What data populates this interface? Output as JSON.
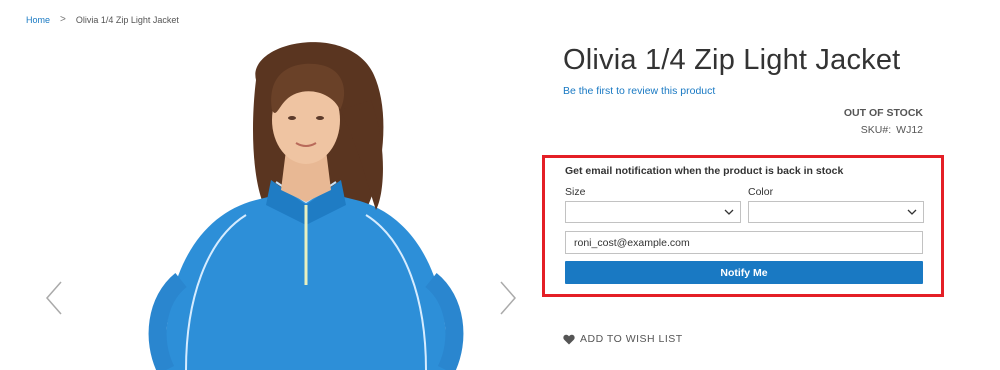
{
  "breadcrumb": {
    "home": "Home",
    "separator": ">",
    "current": "Olivia 1/4 Zip Light Jacket"
  },
  "gallery": {
    "prev_icon": "chevron-left-icon",
    "next_icon": "chevron-right-icon",
    "image_alt": "Woman wearing a blue quarter-zip light jacket"
  },
  "product": {
    "title": "Olivia 1/4 Zip Light Jacket",
    "review_link": "Be the first to review this product",
    "stock_status": "OUT OF STOCK",
    "sku_label": "SKU#:",
    "sku_value": "WJ12"
  },
  "notify": {
    "heading": "Get email notification when the product is back in stock",
    "size_label": "Size",
    "size_value": "",
    "color_label": "Color",
    "color_value": "",
    "email_value": "roni_cost@example.com",
    "button_label": "Notify Me",
    "highlight_color": "#e41f26"
  },
  "wishlist": {
    "icon": "heart-icon",
    "label": "ADD TO WISH LIST"
  },
  "colors": {
    "link": "#1979c3",
    "button": "#1979c3",
    "jacket": "#2d8fd8"
  }
}
